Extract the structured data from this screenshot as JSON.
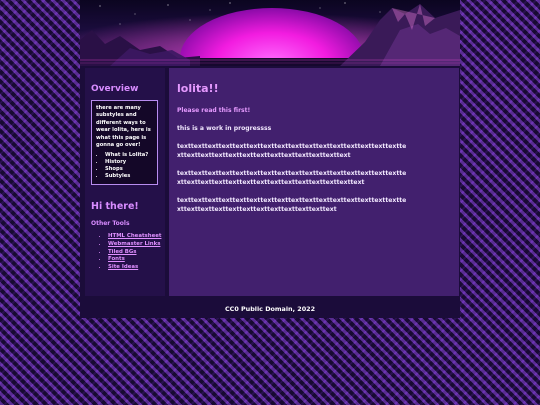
{
  "sidebar": {
    "overview_title": "Overview",
    "note_text": "there are many substyles and different ways to wear lolita, here is what this page is gonna go over!",
    "note_items": [
      "What is Lolita?",
      "History",
      "Shops",
      "Subtyles"
    ],
    "greeting": "Hi there!",
    "tools_title": "Other Tools",
    "tools": [
      "HTML Cheatsheet",
      "Webmaster Links",
      "Tiled BGs",
      "Fonts",
      "Site Ideas"
    ]
  },
  "main": {
    "title": "lolita!!",
    "lead": "Please read this first!",
    "progress": "this is a work in progressss",
    "paragraphs": [
      "texttexttexttexttexttexttexttexttexttexttexttexttexttexttexttexttexttexttexttexttexttexttexttexttexttexttexttexttext",
      "texttexttexttexttexttexttexttexttexttexttexttexttexttexttexttexttexttexttexttexttexttexttexttexttexttexttexttexttexttext",
      "texttexttexttexttexttexttexttexttexttexttexttexttexttexttexttexttexttexttexttexttexttexttexttexttexttexttexttext"
    ]
  },
  "footer": {
    "text": "CC0 Public Domain, 2022"
  },
  "colors": {
    "accent": "#e69aff",
    "panel": "#42206e",
    "sidebar": "#241049",
    "page": "#1b0c3a"
  }
}
